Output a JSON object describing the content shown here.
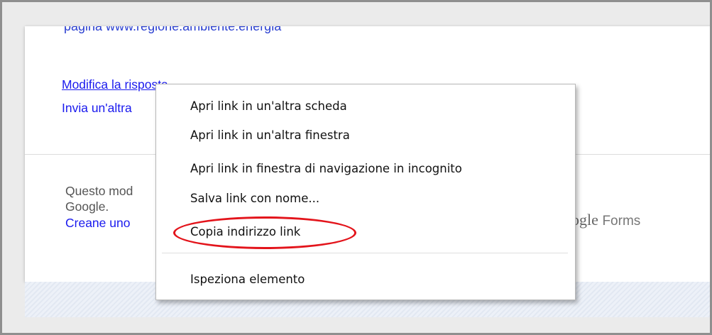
{
  "page": {
    "cut_link_text": "pagina www.regione.ambiente.energia",
    "edit_response_link": "Modifica la risposta",
    "submit_another_link": "Invia un'altra",
    "footer_line1": "Questo mod",
    "footer_line2": "Google.",
    "footer_create_link": "Creane uno",
    "brand_google_fragment": "ogle",
    "brand_forms": "Forms"
  },
  "context_menu": {
    "items": [
      {
        "label": "Apri link in un'altra scheda"
      },
      {
        "label": "Apri link in un'altra finestra"
      },
      {
        "label": "Apri link in finestra di navigazione in incognito"
      },
      {
        "label": "Salva link con nome..."
      },
      {
        "label": "Copia indirizzo link"
      },
      {
        "label": "Ispeziona elemento"
      }
    ]
  },
  "colors": {
    "link": "#1a1aee",
    "highlight": "#e3141b",
    "frame_border": "#8f8f8f"
  }
}
